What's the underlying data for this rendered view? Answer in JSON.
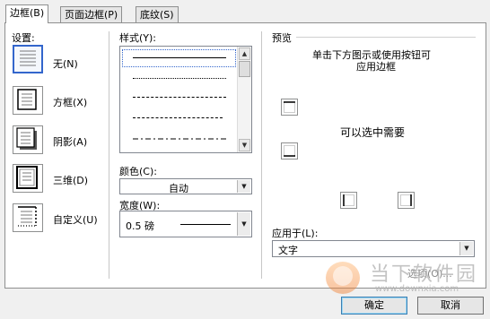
{
  "tabs": [
    {
      "label": "边框(B)"
    },
    {
      "label": "页面边框(P)"
    },
    {
      "label": "底纹(S)"
    }
  ],
  "setting": {
    "title": "设置:",
    "items": [
      {
        "label": "无(N)"
      },
      {
        "label": "方框(X)"
      },
      {
        "label": "阴影(A)"
      },
      {
        "label": "三维(D)"
      },
      {
        "label": "自定义(U)"
      }
    ]
  },
  "style": {
    "title": "样式(Y):",
    "lines": [
      "solid",
      "dotted",
      "dashed-fine",
      "dashed",
      "dash-dot"
    ]
  },
  "color": {
    "label": "颜色(C):",
    "value": "自动"
  },
  "width": {
    "label": "宽度(W):",
    "value": "0.5 磅"
  },
  "preview": {
    "title": "预览",
    "hint_line1": "单击下方图示或使用按钮可",
    "hint_line2": "应用边框",
    "center_text": "可以选中需要"
  },
  "apply_to": {
    "label": "应用于(L):",
    "value": "文字"
  },
  "options_label": "选项(O)...",
  "buttons": {
    "ok": "确定",
    "cancel": "取消"
  },
  "watermark": {
    "brand": "当下软件园",
    "url": "www.downxia.com"
  },
  "colors": {
    "selection": "#3366cc",
    "panel": "#ffffff",
    "dialog_bg": "#f0f0f0"
  }
}
